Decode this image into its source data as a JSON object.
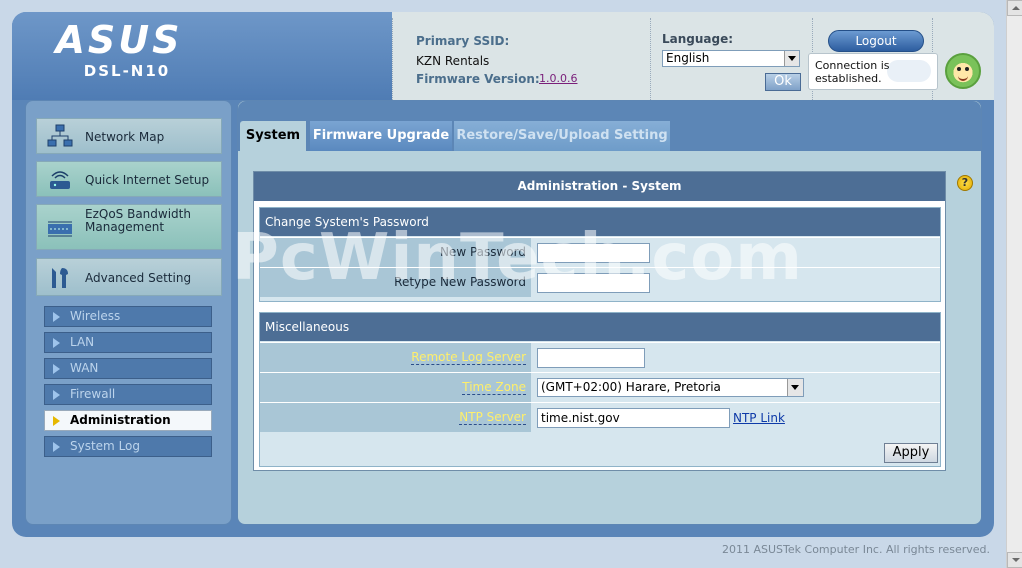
{
  "header": {
    "brand": "ASUS",
    "model": "DSL-N10",
    "primary_ssid_label": "Primary SSID:",
    "primary_ssid_value": "KZN Rentals",
    "firmware_label": "Firmware Version:",
    "firmware_value": "1.0.0.6",
    "language_label": "Language:",
    "language_value": "English",
    "ok_label": "Ok",
    "logout_label": "Logout",
    "connection_status": "Connection is established."
  },
  "sidebar": {
    "items": [
      {
        "label": "Network Map",
        "icon": "network-map-icon"
      },
      {
        "label": "Quick Internet Setup",
        "icon": "router-icon"
      },
      {
        "label": "EzQoS Bandwidth Management",
        "icon": "bandwidth-icon"
      },
      {
        "label": "Advanced Setting",
        "icon": "wrench-icon"
      }
    ],
    "subitems": [
      {
        "label": "Wireless"
      },
      {
        "label": "LAN"
      },
      {
        "label": "WAN"
      },
      {
        "label": "Firewall"
      },
      {
        "label": "Administration",
        "active": true
      },
      {
        "label": "System Log"
      }
    ]
  },
  "tabs": [
    {
      "label": "System",
      "active": true
    },
    {
      "label": "Firmware Upgrade"
    },
    {
      "label": "Restore/Save/Upload Setting"
    }
  ],
  "main": {
    "title": "Administration - System",
    "password_section": {
      "title": "Change System's Password",
      "new_password_label": "New Password",
      "new_password_value": "",
      "retype_password_label": "Retype New Password",
      "retype_password_value": ""
    },
    "misc_section": {
      "title": "Miscellaneous",
      "remote_log_label": "Remote Log Server",
      "remote_log_value": "",
      "timezone_label": "Time Zone",
      "timezone_value": "(GMT+02:00) Harare, Pretoria",
      "ntp_label": "NTP Server",
      "ntp_value": "time.nist.gov",
      "ntp_link": "NTP Link"
    },
    "apply_label": "Apply"
  },
  "help_icon": "?",
  "watermark": "PcWinTech.com",
  "footer": "2011 ASUSTek Computer Inc. All rights reserved.",
  "colors": {
    "frame": "#5a85b8",
    "header_info": "#dbe4e6",
    "panel": "#b6d1dc",
    "section_header": "#4d6e95",
    "label_cell": "#a9c6d6",
    "link_label": "#ffef6a"
  }
}
